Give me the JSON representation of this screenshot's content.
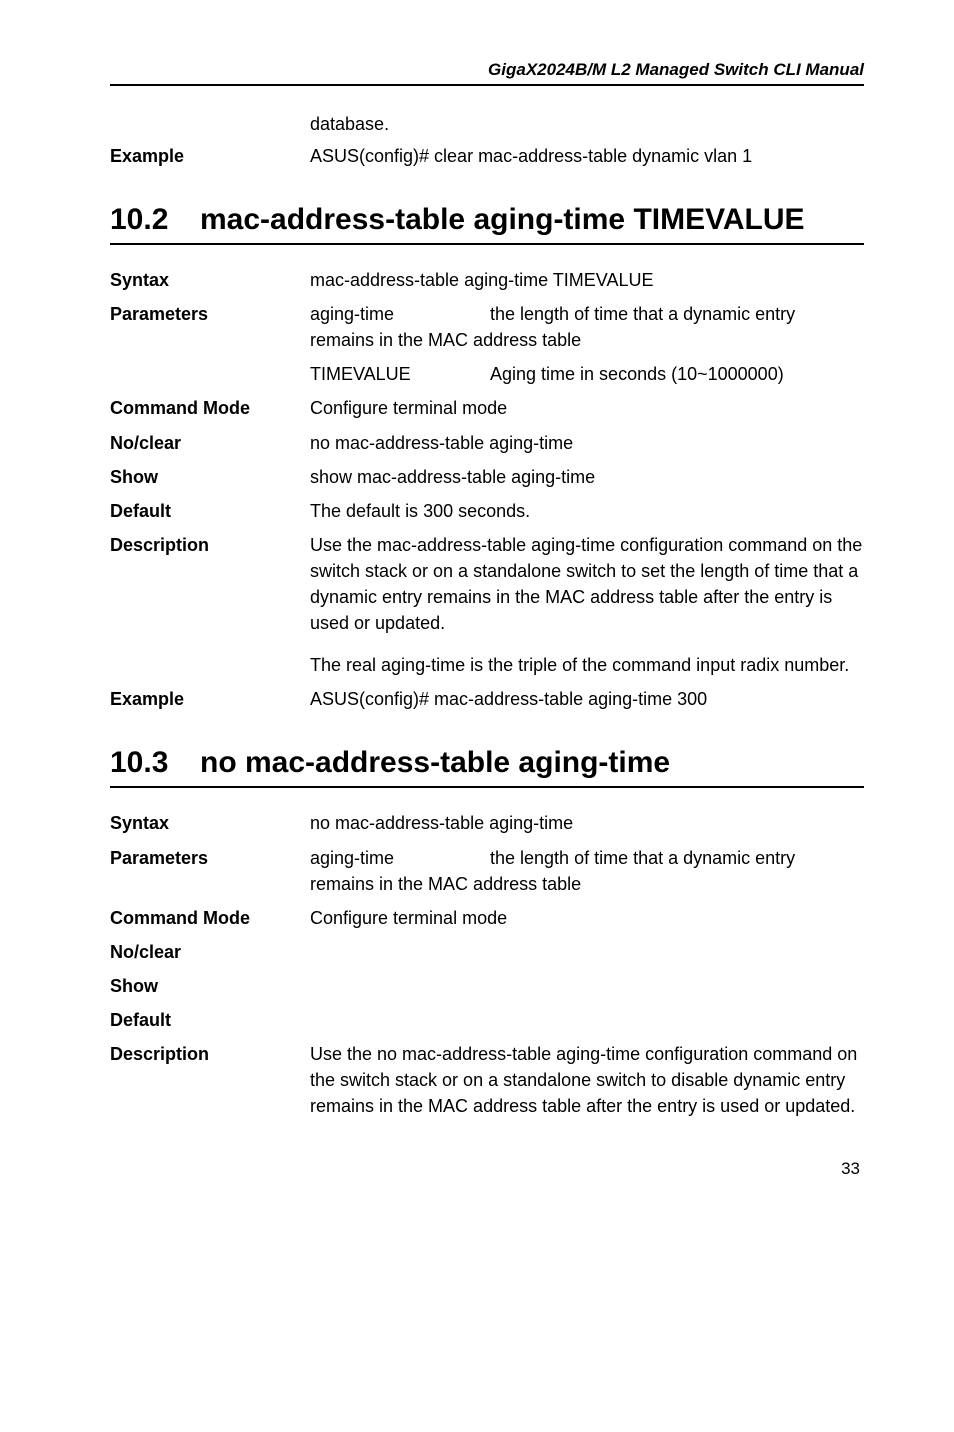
{
  "header": {
    "title": "GigaX2024B/M L2 Managed Switch CLI Manual"
  },
  "continuation": {
    "text": "database.",
    "example_label": "Example",
    "example_value": "ASUS(config)# clear mac-address-table dynamic vlan 1"
  },
  "section_102": {
    "num": "10.2",
    "title": "mac-address-table aging-time TIMEVALUE",
    "rows": {
      "syntax_label": "Syntax",
      "syntax_value": "mac-address-table aging-time TIMEVALUE",
      "parameters_label": "Parameters",
      "param1_name": "aging-time",
      "param1_desc": "the length of time that a dynamic entry remains in the MAC address table",
      "param2_name": "TIMEVALUE",
      "param2_desc": "Aging time in seconds (10~1000000)",
      "command_mode_label": "Command Mode",
      "command_mode_value": "Configure terminal mode",
      "noclear_label": "No/clear",
      "noclear_value": "no mac-address-table aging-time",
      "show_label": "Show",
      "show_value": "show mac-address-table aging-time",
      "default_label": "Default",
      "default_value": "The default is 300 seconds.",
      "description_label": "Description",
      "description_value1": "Use the mac-address-table aging-time configuration command on the switch stack or on a standalone switch to set the length of time that a dynamic entry remains in the MAC address table after the entry is used or updated.",
      "description_value2": "The real aging-time is the triple of the command input radix number.",
      "example_label": "Example",
      "example_value": "ASUS(config)# mac-address-table aging-time 300"
    }
  },
  "section_103": {
    "num": "10.3",
    "title": "no mac-address-table aging-time",
    "rows": {
      "syntax_label": "Syntax",
      "syntax_value": "no mac-address-table aging-time",
      "parameters_label": "Parameters",
      "param1_name": "aging-time",
      "param1_desc": "the length of time that a dynamic entry remains in the MAC address table",
      "command_mode_label": "Command Mode",
      "command_mode_value": "Configure terminal mode",
      "noclear_label": "No/clear",
      "show_label": "Show",
      "default_label": "Default",
      "description_label": "Description",
      "description_value": "Use the no mac-address-table aging-time configuration command on the switch stack or on a standalone switch to disable dynamic entry remains in the MAC address table after the entry is used or updated."
    }
  },
  "page_number": "33"
}
